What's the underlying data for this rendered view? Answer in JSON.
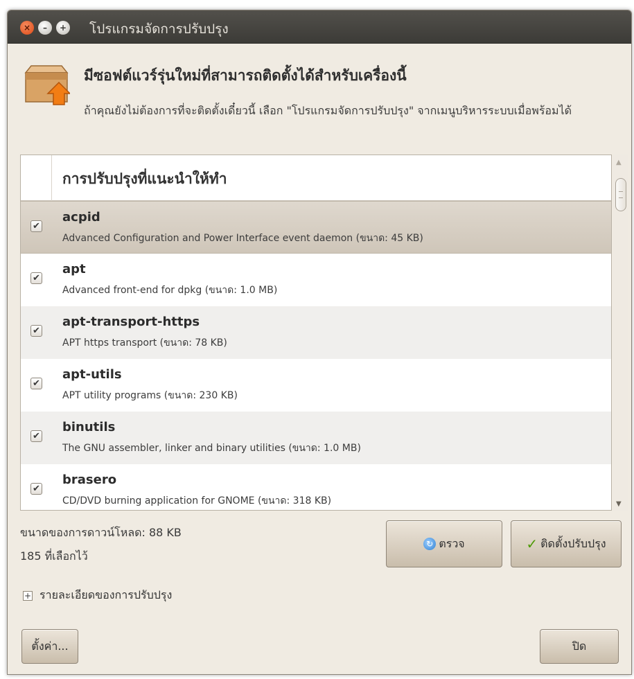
{
  "window": {
    "title": "โปรแกรมจัดการปรับปรุง",
    "buttons": {
      "close": "×",
      "minimize": "–",
      "maximize": "+"
    }
  },
  "header": {
    "icon": "package-upgrade-icon",
    "headline": "มีซอฟต์แวร์รุ่นใหม่ที่สามารถติดตั้งได้สำหรับเครื่องนี้",
    "description": "ถ้าคุณยังไม่ต้องการที่จะติดตั้งเดี๋ยวนี้ เลือก \"โปรแกรมจัดการปรับปรุง\" จากเมนูบริหารระบบเมื่อพร้อมได้"
  },
  "update_list": {
    "section_title": "การปรับปรุงที่แนะนำให้ทำ",
    "check_mark": "✔",
    "items": [
      {
        "name": "acpid",
        "description": "Advanced Configuration and Power Interface event daemon (ขนาด: 45 KB)",
        "checked": true,
        "selected": true
      },
      {
        "name": "apt",
        "description": "Advanced front-end for dpkg (ขนาด: 1.0 MB)",
        "checked": true,
        "selected": false
      },
      {
        "name": "apt-transport-https",
        "description": "APT https transport (ขนาด: 78 KB)",
        "checked": true,
        "selected": false
      },
      {
        "name": "apt-utils",
        "description": "APT utility programs (ขนาด: 230 KB)",
        "checked": true,
        "selected": false
      },
      {
        "name": "binutils",
        "description": "The GNU assembler, linker and binary utilities (ขนาด: 1.0 MB)",
        "checked": true,
        "selected": false
      },
      {
        "name": "brasero",
        "description": "CD/DVD burning application for GNOME (ขนาด: 318 KB)",
        "checked": true,
        "selected": false
      }
    ]
  },
  "summary": {
    "download_size": "ขนาดของการดาวน์โหลด: 88 KB",
    "selected_count": "185 ที่เลือกไว้"
  },
  "actions": {
    "check_label": "ตรวจ",
    "install_label": "ติดตั้งปรับปรุง",
    "settings_label": "ตั้งค่า...",
    "close_label": "ปิด"
  },
  "details": {
    "toggle": "+",
    "label": "รายละเอียดของการปรับปรุง"
  },
  "colors": {
    "titlebar": "#3c3b37",
    "window_bg": "#f0ebe2",
    "selected_row": "#d8d0c4",
    "accent_close": "#df4a16"
  }
}
